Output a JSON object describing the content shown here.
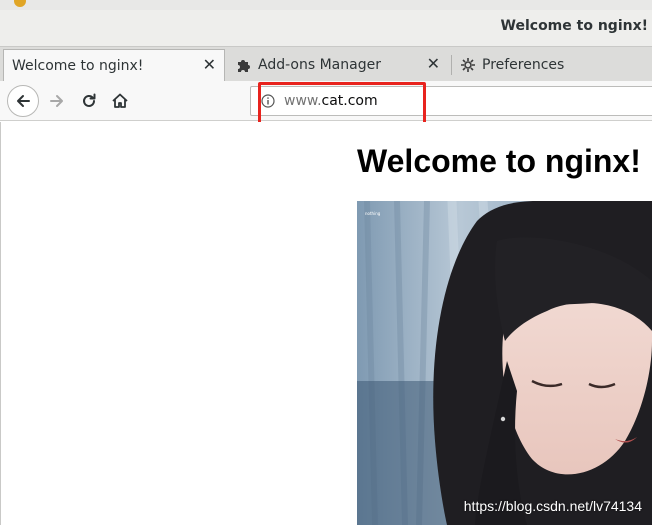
{
  "window": {
    "title": "Welcome to nginx!"
  },
  "tabs": [
    {
      "label": "Welcome to nginx!",
      "active": true,
      "close_glyph": "✕"
    },
    {
      "label": "Add-ons Manager",
      "active": false,
      "icon": "puzzle-icon",
      "close_glyph": "✕"
    },
    {
      "label": "Preferences",
      "active": false,
      "icon": "gear-icon"
    }
  ],
  "navbar": {
    "url_scheme": "www.",
    "url_host": "cat.com"
  },
  "page": {
    "heading": "Welcome to nginx!",
    "image_watermark": "https://blog.csdn.net/lv74134"
  },
  "colors": {
    "annotation": "#e8231e",
    "tabbar": "#dcdcda",
    "active_tab": "#f8f8f8"
  }
}
